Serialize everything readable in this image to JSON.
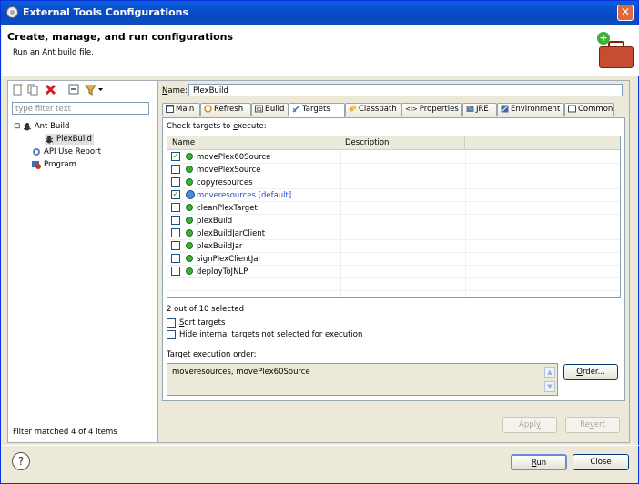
{
  "window": {
    "title": "External Tools Configurations",
    "close": "✕"
  },
  "header": {
    "title": "Create, manage, and run configurations",
    "subtitle": "Run an Ant build file.",
    "plus": "+"
  },
  "left": {
    "toolbar": [
      "new-config-icon",
      "duplicate-icon",
      "delete-icon",
      "collapse-all-icon",
      "filter-icon"
    ],
    "filter_placeholder": "type filter text",
    "tree": [
      {
        "label": "Ant Build",
        "expander": "⊟",
        "icon": "ant-icon"
      },
      {
        "label": "PlexBuild",
        "icon": "ant-icon",
        "selected": true
      },
      {
        "label": "API Use Report",
        "icon": "report-icon"
      },
      {
        "label": "Program",
        "icon": "program-icon"
      }
    ],
    "status": "Filter matched 4 of 4 items"
  },
  "right": {
    "name_label": "Name:",
    "name_value": "PlexBuild",
    "tabs": [
      {
        "label": "Main"
      },
      {
        "label": "Refresh"
      },
      {
        "label": "Build"
      },
      {
        "label": "Targets",
        "active": true
      },
      {
        "label": "Classpath"
      },
      {
        "label": "Properties"
      },
      {
        "label": "JRE"
      },
      {
        "label": "Environment"
      },
      {
        "label": "Common"
      }
    ],
    "check_label": "Check targets to execute:",
    "columns": [
      "Name",
      "Description"
    ],
    "targets": [
      {
        "name": "movePlex60Source",
        "checked": true
      },
      {
        "name": "movePlexSource",
        "checked": false
      },
      {
        "name": "copyresources",
        "checked": false
      },
      {
        "name": "moveresources [default]",
        "checked": true,
        "default": true
      },
      {
        "name": "cleanPlexTarget",
        "checked": false
      },
      {
        "name": "plexBuild",
        "checked": false
      },
      {
        "name": "plexBuildJarClient",
        "checked": false
      },
      {
        "name": "plexBuildJar",
        "checked": false
      },
      {
        "name": "signPlexClientJar",
        "checked": false
      },
      {
        "name": "deployToJNLP",
        "checked": false
      }
    ],
    "summary": "2 out of 10 selected",
    "sort_label": "Sort targets",
    "hide_label": "Hide internal targets not selected for execution",
    "order_label": "Target execution order:",
    "order_value": "moveresources, movePlex60Source",
    "order_button": "Order...",
    "apply_button": "Apply",
    "revert_button": "Revert"
  },
  "footer": {
    "help": "?",
    "run_button": "Run",
    "close_button": "Close"
  }
}
